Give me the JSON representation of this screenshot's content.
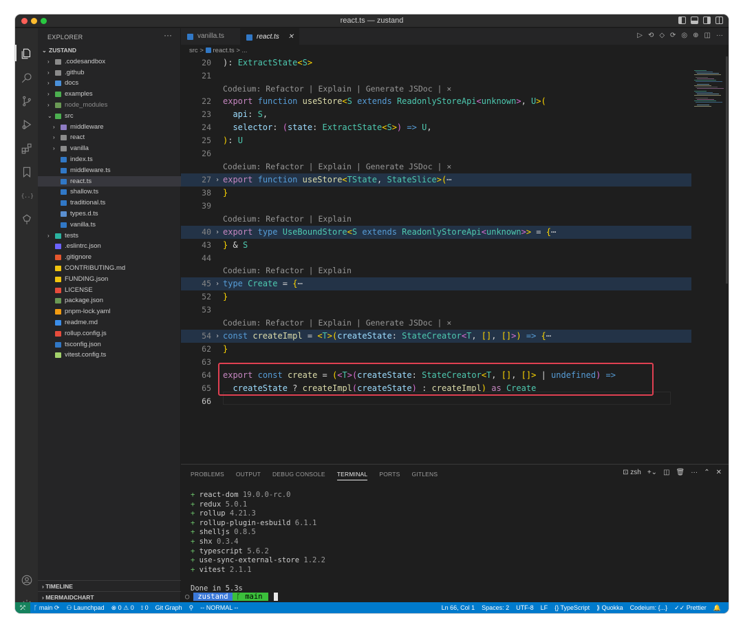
{
  "window": {
    "title": "react.ts — zustand"
  },
  "sidebar": {
    "header": "EXPLORER",
    "more": "···",
    "root": "ZUSTAND",
    "items": [
      {
        "label": ".codesandbox",
        "kind": "folder",
        "depth": 1,
        "color": "#8b8b8b"
      },
      {
        "label": ".github",
        "kind": "folder",
        "depth": 1,
        "color": "#8b8b8b"
      },
      {
        "label": "docs",
        "kind": "folder",
        "depth": 1,
        "color": "#4a90d9"
      },
      {
        "label": "examples",
        "kind": "folder",
        "depth": 1,
        "color": "#4caf50"
      },
      {
        "label": "node_modules",
        "kind": "folder",
        "depth": 1,
        "color": "#6a9955"
      },
      {
        "label": "src",
        "kind": "folder-open",
        "depth": 1,
        "color": "#4caf50"
      },
      {
        "label": "middleware",
        "kind": "folder",
        "depth": 2,
        "color": "#8e7cc3"
      },
      {
        "label": "react",
        "kind": "folder",
        "depth": 2,
        "color": "#8b8b8b"
      },
      {
        "label": "vanilla",
        "kind": "folder",
        "depth": 2,
        "color": "#8b8b8b"
      },
      {
        "label": "index.ts",
        "kind": "file",
        "depth": 2,
        "color": "#3178c6"
      },
      {
        "label": "middleware.ts",
        "kind": "file",
        "depth": 2,
        "color": "#3178c6"
      },
      {
        "label": "react.ts",
        "kind": "file",
        "depth": 2,
        "color": "#3178c6",
        "selected": true
      },
      {
        "label": "shallow.ts",
        "kind": "file",
        "depth": 2,
        "color": "#3178c6"
      },
      {
        "label": "traditional.ts",
        "kind": "file",
        "depth": 2,
        "color": "#3178c6"
      },
      {
        "label": "types.d.ts",
        "kind": "file",
        "depth": 2,
        "color": "#5a8fd0"
      },
      {
        "label": "vanilla.ts",
        "kind": "file",
        "depth": 2,
        "color": "#3178c6"
      },
      {
        "label": "tests",
        "kind": "folder",
        "depth": 1,
        "color": "#2bb3a0"
      },
      {
        "label": ".eslintrc.json",
        "kind": "file",
        "depth": 1,
        "color": "#6c63ff"
      },
      {
        "label": ".gitignore",
        "kind": "file",
        "depth": 1,
        "color": "#e4572e"
      },
      {
        "label": "CONTRIBUTING.md",
        "kind": "file",
        "depth": 1,
        "color": "#f1c40f"
      },
      {
        "label": "FUNDING.json",
        "kind": "file",
        "depth": 1,
        "color": "#f1c40f"
      },
      {
        "label": "LICENSE",
        "kind": "file",
        "depth": 1,
        "color": "#e74c3c"
      },
      {
        "label": "package.json",
        "kind": "file",
        "depth": 1,
        "color": "#6a9955"
      },
      {
        "label": "pnpm-lock.yaml",
        "kind": "file",
        "depth": 1,
        "color": "#f39c12"
      },
      {
        "label": "readme.md",
        "kind": "file",
        "depth": 1,
        "color": "#3b8eea"
      },
      {
        "label": "rollup.config.js",
        "kind": "file",
        "depth": 1,
        "color": "#e74c3c"
      },
      {
        "label": "tsconfig.json",
        "kind": "file",
        "depth": 1,
        "color": "#3178c6"
      },
      {
        "label": "vitest.config.ts",
        "kind": "file",
        "depth": 1,
        "color": "#a3d16b"
      }
    ],
    "sections": [
      "TIMELINE",
      "MERMAIDCHART"
    ]
  },
  "tabs": [
    {
      "label": "vanilla.ts",
      "active": false
    },
    {
      "label": "react.ts",
      "active": true
    }
  ],
  "breadcrumb": {
    "folder": "src",
    "sep": ">",
    "file": "react.ts",
    "tail": "> ..."
  },
  "codelens": {
    "full": "Codeium: Refactor | Explain | Generate JSDoc | ×",
    "short": "Codeium: Refactor | Explain"
  },
  "editor": {
    "line_numbers": [
      "20",
      "21",
      "",
      "22",
      "23",
      "24",
      "25",
      "26",
      "",
      "27",
      "38",
      "39",
      "",
      "40",
      "43",
      "44",
      "",
      "45",
      "52",
      "53",
      "",
      "54",
      "62",
      "63",
      "64",
      "65",
      "66"
    ]
  },
  "panel": {
    "tabs": [
      "PROBLEMS",
      "OUTPUT",
      "DEBUG CONSOLE",
      "TERMINAL",
      "PORTS",
      "GITLENS"
    ],
    "active_tab": "TERMINAL",
    "shell": "zsh",
    "packages": [
      {
        "name": "react-dom",
        "version": "19.0.0-rc.0"
      },
      {
        "name": "redux",
        "version": "5.0.1"
      },
      {
        "name": "rollup",
        "version": "4.21.3"
      },
      {
        "name": "rollup-plugin-esbuild",
        "version": "6.1.1"
      },
      {
        "name": "shelljs",
        "version": "0.8.5"
      },
      {
        "name": "shx",
        "version": "0.3.4"
      },
      {
        "name": "typescript",
        "version": "5.6.2"
      },
      {
        "name": "use-sync-external-store",
        "version": "1.2.2"
      },
      {
        "name": "vitest",
        "version": "2.1.1"
      }
    ],
    "done": "Done in 5.3s",
    "prompt_dir": "zustand",
    "prompt_branch": "main"
  },
  "statusbar": {
    "branch": "main",
    "launchpad": "Launchpad",
    "errors": "0",
    "warnings": "0",
    "ports": "0",
    "git_graph": "Git Graph",
    "mode": "-- NORMAL --",
    "position": "Ln 66, Col 1",
    "spaces": "Spaces: 2",
    "encoding": "UTF-8",
    "eol": "LF",
    "language": "TypeScript",
    "quokka": "Quokka",
    "codeium": "Codeium: {...}",
    "prettier": "Prettier"
  }
}
